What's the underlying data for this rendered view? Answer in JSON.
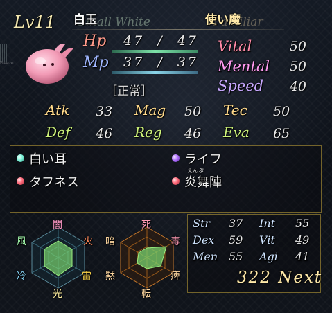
{
  "header": {
    "level": "Lv11",
    "name_jp": "白玉",
    "name_en": "Small White",
    "class_jp": "使い魔",
    "class_en": "Familiar"
  },
  "portrait": {
    "watermark": "Freeze"
  },
  "gauges": {
    "hp_label": "Hp",
    "hp_current": "47",
    "hp_slash": "/",
    "hp_max": "47",
    "mp_label": "Mp",
    "mp_current": "37",
    "mp_slash": "/",
    "mp_max": "37",
    "status": "［正常］"
  },
  "vitals": [
    {
      "label": "Vital",
      "value": "50"
    },
    {
      "label": "Mental",
      "value": "50"
    },
    {
      "label": "Speed",
      "value": "40"
    }
  ],
  "stats": {
    "atk_label": "Atk",
    "atk": "33",
    "mag_label": "Mag",
    "mag": "50",
    "tec_label": "Tec",
    "tec": "50",
    "def_label": "Def",
    "def": "46",
    "reg_label": "Reg",
    "reg": "46",
    "eva_label": "Eva",
    "eva": "65"
  },
  "skills": [
    {
      "name": "白い耳",
      "gem_color": "#7ff2d8"
    },
    {
      "name": "ライフ",
      "gem_color": "#b070ff"
    },
    {
      "name": "タフネス",
      "gem_color": "#ff6a7a"
    },
    {
      "name": "炎舞陣",
      "ruby": "えんぶ",
      "gem_color": "#ff6a7a"
    }
  ],
  "elements_left": {
    "top": "闇",
    "right_top": "火",
    "right_bottom": "雷",
    "bottom": "光",
    "left_bottom": "冷",
    "left_top": "風"
  },
  "elements_right": {
    "top": "死",
    "right_top": "毒",
    "right_bottom": "痺",
    "bottom": "転",
    "left_bottom": "黙",
    "left_top": "暗"
  },
  "attributes": [
    {
      "label": "Str",
      "value": "37"
    },
    {
      "label": "Int",
      "value": "55"
    },
    {
      "label": "Dex",
      "value": "59"
    },
    {
      "label": "Vit",
      "value": "49"
    },
    {
      "label": "Men",
      "value": "55"
    },
    {
      "label": "Agi",
      "value": "41"
    }
  ],
  "next_exp": {
    "value": "322",
    "label": "Next"
  },
  "colors": {
    "hp": "#ff9a8a",
    "mp": "#9fb6ff",
    "panel_border": "#c8aa3c",
    "stat_label": "#ffd98a"
  }
}
